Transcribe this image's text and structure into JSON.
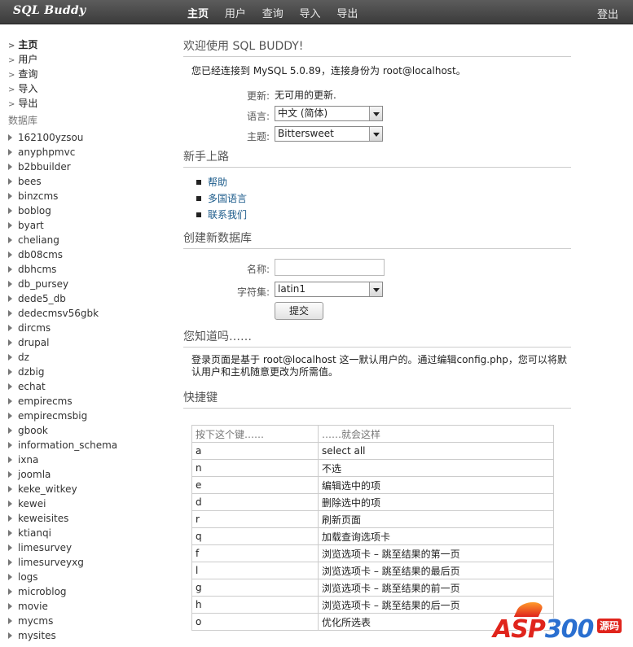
{
  "app": {
    "logo": "SQL Buddy"
  },
  "topnav": {
    "items": [
      "主页",
      "用户",
      "查询",
      "导入",
      "导出"
    ],
    "logout": "登出"
  },
  "sidebar": {
    "links": [
      "主页",
      "用户",
      "查询",
      "导入",
      "导出"
    ],
    "db_heading": "数据库",
    "databases": [
      "162100yzsou",
      "anyphpmvc",
      "b2bbuilder",
      "bees",
      "binzcms",
      "boblog",
      "byart",
      "cheliang",
      "db08cms",
      "dbhcms",
      "db_pursey",
      "dede5_db",
      "dedecmsv56gbk",
      "dircms",
      "drupal",
      "dz",
      "dzbig",
      "echat",
      "empirecms",
      "empirecmsbig",
      "gbook",
      "information_schema",
      "ixna",
      "joomla",
      "keke_witkey",
      "kewei",
      "keweisites",
      "ktianqi",
      "limesurvey",
      "limesurveyxg",
      "logs",
      "microblog",
      "movie",
      "mycms",
      "mysites"
    ]
  },
  "welcome": {
    "title": "欢迎使用 SQL BUDDY!",
    "connected": "您已经连接到 MySQL 5.0.89，连接身份为 root@localhost。",
    "update_label": "更新:",
    "update_value": "无可用的更新.",
    "language_label": "语言:",
    "language_value": "中文 (简体)",
    "theme_label": "主题:",
    "theme_value": "Bittersweet"
  },
  "getting_started": {
    "title": "新手上路",
    "links": [
      "帮助",
      "多国语言",
      "联系我们"
    ]
  },
  "create_db": {
    "title": "创建新数据库",
    "name_label": "名称:",
    "name_value": "",
    "charset_label": "字符集:",
    "charset_value": "latin1",
    "submit": "提交"
  },
  "did_you_know": {
    "title": "您知道吗……",
    "text": "登录页面是基于 root@localhost 这一默认用户的。通过编辑config.php，您可以将默认用户和主机随意更改为所需值。"
  },
  "shortcuts": {
    "title": "快捷键",
    "headers": [
      "按下这个键……",
      "……就会这样"
    ],
    "rows": [
      [
        "a",
        "select all"
      ],
      [
        "n",
        "不选"
      ],
      [
        "e",
        "编辑选中的项"
      ],
      [
        "d",
        "删除选中的项"
      ],
      [
        "r",
        "刷新页面"
      ],
      [
        "q",
        "加载查询选项卡"
      ],
      [
        "f",
        "浏览选项卡 – 跳至结果的第一页"
      ],
      [
        "l",
        "浏览选项卡 – 跳至结果的最后页"
      ],
      [
        "g",
        "浏览选项卡 – 跳至结果的前一页"
      ],
      [
        "h",
        "浏览选项卡 – 跳至结果的后一页"
      ],
      [
        "o",
        "优化所选表"
      ]
    ]
  },
  "watermark": {
    "brand": "ASP",
    "num": "300",
    "badge": "源码"
  }
}
